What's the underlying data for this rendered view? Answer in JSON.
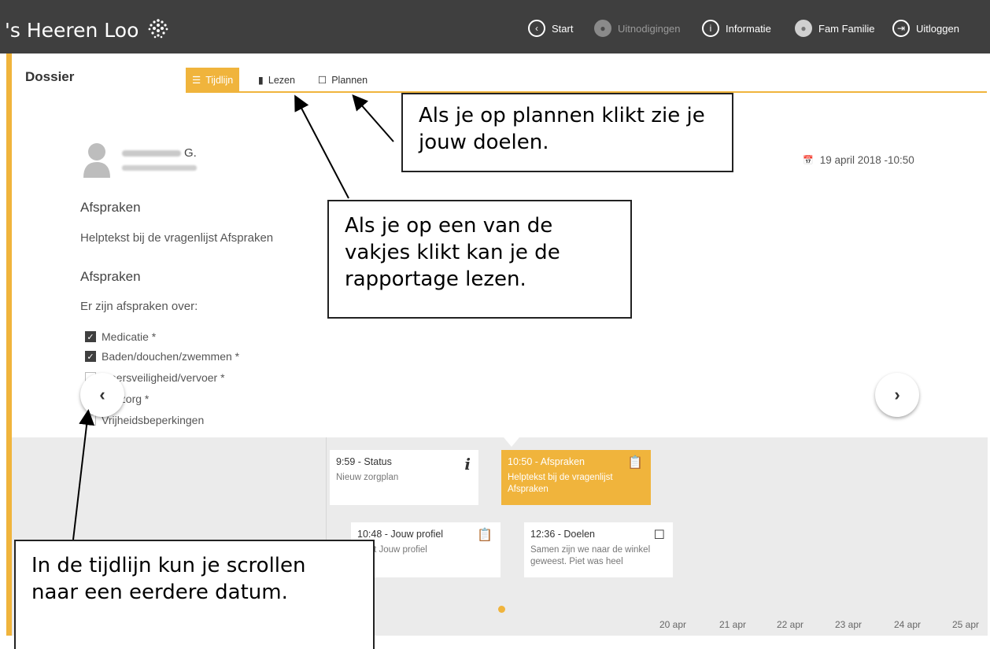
{
  "brand": {
    "name": "'s Heeren Loo"
  },
  "nav": [
    {
      "label": "Start",
      "icon": "back-arrow-icon"
    },
    {
      "label": "Uitnodigingen",
      "icon": "invitations-icon"
    },
    {
      "label": "Informatie",
      "icon": "info-icon"
    },
    {
      "label": "Fam Familie",
      "icon": "user-avatar-icon"
    },
    {
      "label": "Uitloggen",
      "icon": "logout-icon"
    }
  ],
  "dossier": {
    "title": "Dossier"
  },
  "tabs": [
    {
      "label": "Tijdlijn",
      "icon": "timeline-icon"
    },
    {
      "label": "Lezen",
      "icon": "book-icon"
    },
    {
      "label": "Plannen",
      "icon": "note-icon"
    }
  ],
  "profile": {
    "name_visible": "G.",
    "date": "19 april 2018 -10:50"
  },
  "content": {
    "heading1": "Afspraken",
    "helptext": "Helptekst bij de vragenlijst Afspraken",
    "heading2": "Afspraken",
    "intro": "Er zijn afspraken over:",
    "checkboxes": [
      {
        "label": "Medicatie *",
        "checked": true
      },
      {
        "label": "Baden/douchen/zwemmen *",
        "checked": true
      },
      {
        "label": "keersveiligheid/vervoer *",
        "checked": false
      },
      {
        "label": "dzorg *",
        "checked": false
      },
      {
        "label": "Vrijheidsbeperkingen",
        "checked": false
      }
    ]
  },
  "timeline": {
    "cards": [
      {
        "title": "9:59 - Status",
        "desc": "Nieuw zorgplan",
        "icon": "info-icon",
        "active": false
      },
      {
        "title": "10:50 - Afspraken",
        "desc": "Helptekst bij de vragenlijst Afspraken",
        "icon": "clipboard-icon",
        "active": true
      },
      {
        "title": "10:48 - Jouw profiel",
        "desc": "tekst Jouw profiel",
        "icon": "clipboard-icon",
        "active": false
      },
      {
        "title": "12:36 - Doelen",
        "desc": "Samen zijn we naar de winkel geweest. Piet was heel",
        "icon": "note-icon",
        "active": false
      }
    ],
    "dates": [
      "20 apr",
      "21 apr",
      "22 apr",
      "23 apr",
      "24 apr",
      "25 apr"
    ]
  },
  "callouts": {
    "plannen": "Als je op plannen klikt zie je jouw doelen.",
    "vakjes": "Als je op een van de vakjes klikt kan je de rapportage lezen.",
    "tijdlijn": "In de tijdlijn kun je scrollen naar een eerdere datum."
  },
  "colors": {
    "accent": "#f0b43c",
    "topbar": "#3f3f3f"
  }
}
